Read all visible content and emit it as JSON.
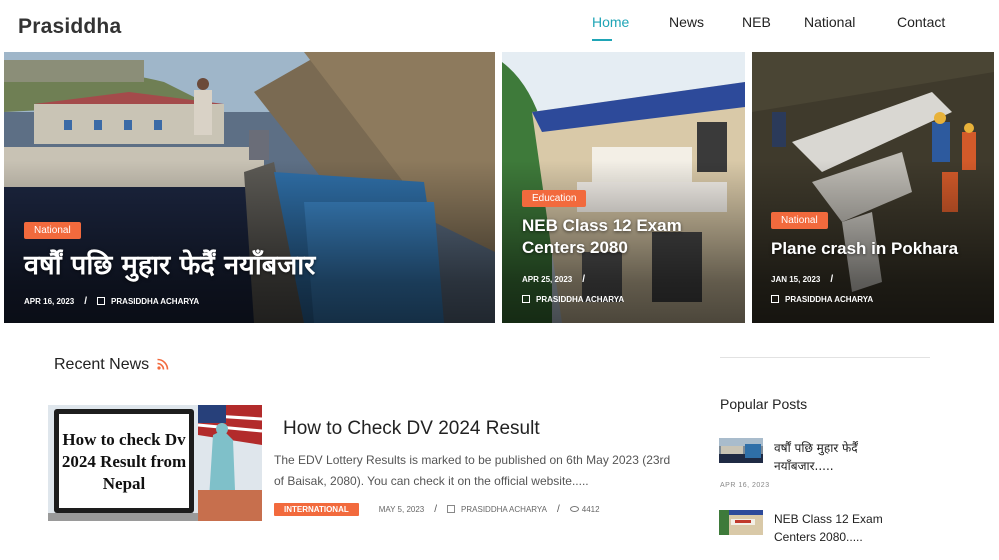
{
  "site": {
    "logo": "Prasiddha"
  },
  "nav": {
    "items": [
      {
        "label": "Home",
        "active": true
      },
      {
        "label": "News",
        "active": false
      },
      {
        "label": "NEB",
        "active": false
      },
      {
        "label": "National",
        "active": false
      },
      {
        "label": "Contact",
        "active": false
      }
    ]
  },
  "hero": [
    {
      "category": "National",
      "title": "वर्षौं पछि मुहार फेर्दैं नयाँबजार",
      "date": "APR 16, 2023",
      "author": "PRASIDDHA ACHARYA"
    },
    {
      "category": "Education",
      "title": "NEB Class 12 Exam Centers 2080",
      "date": "APR 25, 2023",
      "author": "PRASIDDHA ACHARYA"
    },
    {
      "category": "National",
      "title": "Plane crash in Pokhara",
      "date": "JAN 15, 2023",
      "author": "PRASIDDHA ACHARYA"
    }
  ],
  "recent": {
    "heading": "Recent News",
    "article": {
      "title": "How to Check DV 2024 Result",
      "excerpt": "The EDV Lottery Results is marked to be published on 6th May 2023 (23rd of Baisak, 2080). You can check it on the official website.....",
      "category": "INTERNATIONAL",
      "date": "MAY 5, 2023",
      "author": "PRASIDDHA ACHARYA",
      "views": "4412",
      "thumb_text": "How to check Dv 2024 Result from Nepal"
    }
  },
  "sidebar": {
    "heading": "Popular Posts",
    "posts": [
      {
        "title": "वर्षौं पछि मुहार फेर्दैं नयाँबजार.....",
        "date": "APR 16, 2023"
      },
      {
        "title": "NEB Class 12 Exam Centers 2080.....",
        "date": ""
      }
    ]
  },
  "colors": {
    "accent": "#1fa5b6",
    "badge": "#f26a3d"
  },
  "icons": {
    "rss": "rss-icon",
    "author": "edit-icon",
    "views": "eye-icon"
  }
}
